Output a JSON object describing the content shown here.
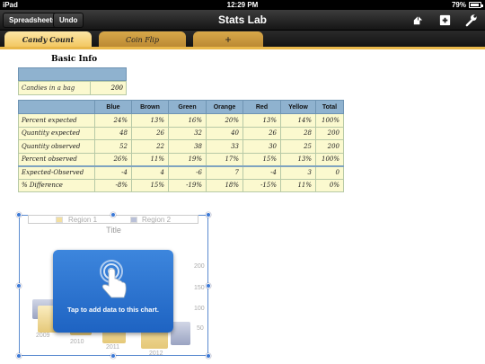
{
  "status": {
    "device": "iPad",
    "time": "12:29 PM",
    "battery": "79%"
  },
  "toolbar": {
    "spreadsheets_label": "Spreadsheets",
    "undo_label": "Undo",
    "title": "Stats Lab",
    "icons": [
      "share-icon",
      "add-icon",
      "settings-wrench-icon"
    ]
  },
  "tabs": [
    {
      "label": "Candy Count",
      "active": true
    },
    {
      "label": "Coin Flip",
      "active": false
    },
    {
      "label": "+",
      "active": false
    }
  ],
  "basic_info": {
    "title": "Basic Info",
    "row_label": "Candies in a bag",
    "row_value": "200"
  },
  "table": {
    "headers": [
      "",
      "Blue",
      "Brown",
      "Green",
      "Orange",
      "Red",
      "Yellow",
      "Total"
    ],
    "rows": [
      [
        "Percent expected",
        "24%",
        "13%",
        "16%",
        "20%",
        "13%",
        "14%",
        "100%"
      ],
      [
        "Quantity expected",
        "48",
        "26",
        "32",
        "40",
        "26",
        "28",
        "200"
      ],
      [
        "Quantity observed",
        "52",
        "22",
        "38",
        "33",
        "30",
        "25",
        "200"
      ],
      [
        "Percent observed",
        "26%",
        "11%",
        "19%",
        "17%",
        "15%",
        "13%",
        "100%"
      ],
      [
        "Expected-Observed",
        "-4",
        "4",
        "-6",
        "7",
        "-4",
        "3",
        "0"
      ],
      [
        "% Difference",
        "-8%",
        "15%",
        "-19%",
        "18%",
        "-15%",
        "11%",
        "0%"
      ]
    ]
  },
  "chart": {
    "legend": [
      "Region 1",
      "Region 2"
    ],
    "title": "Title",
    "y_ticks": [
      "200",
      "150",
      "100",
      "50"
    ],
    "x_ticks": [
      "2009",
      "2010",
      "2011",
      "2012"
    ],
    "overlay_message": "Tap to add data to this chart.",
    "colors": {
      "region1": "#f3dfa0",
      "region2": "#b9c0d8",
      "accent": "#2a6fd0"
    }
  }
}
